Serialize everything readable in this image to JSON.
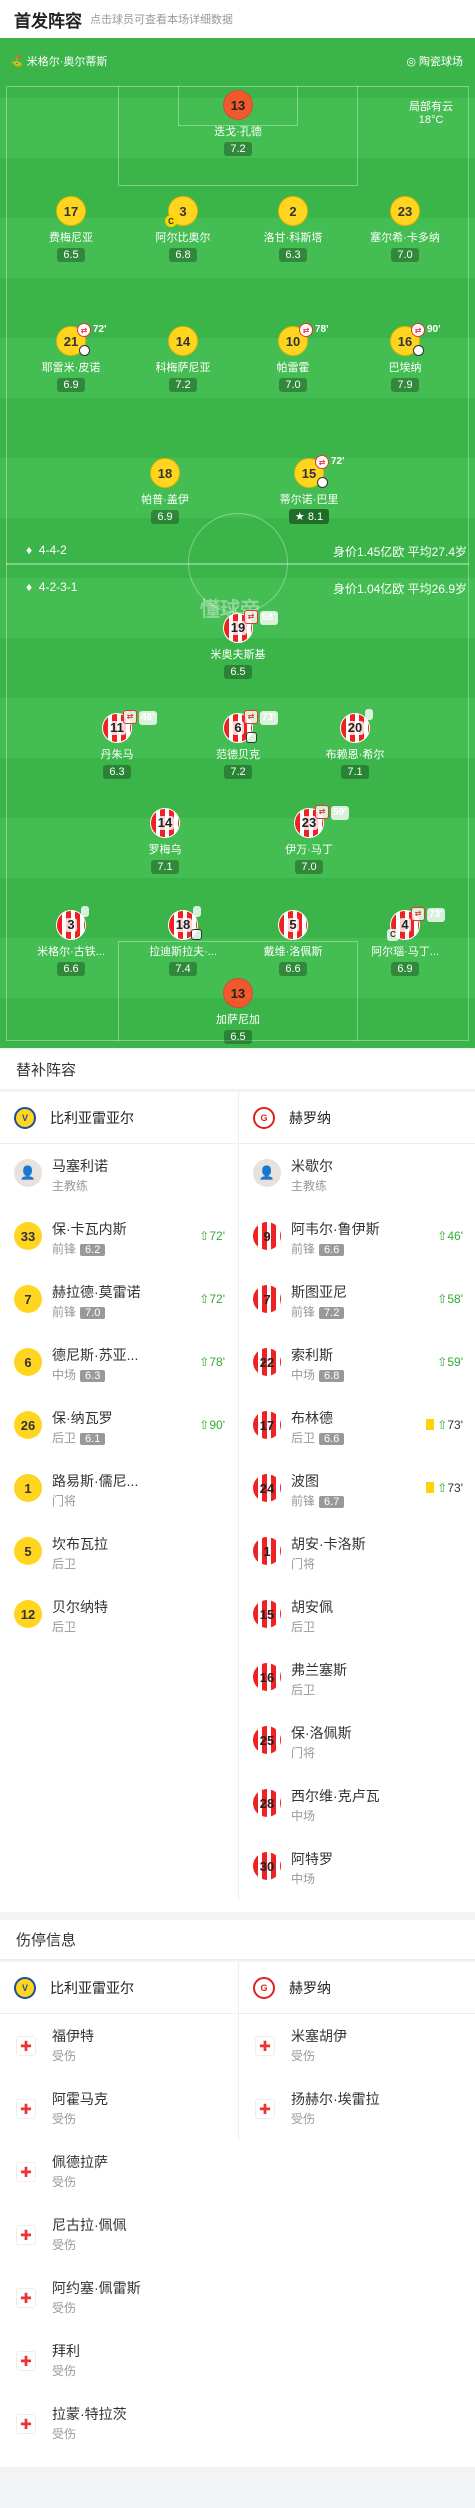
{
  "header": {
    "title": "首发阵容",
    "subtitle": "点击球员可查看本场详细数据"
  },
  "pitch": {
    "referee": "米格尔·奥尔蒂斯",
    "stadium": "陶瓷球场",
    "weather": "局部有云",
    "temperature": "18°C",
    "watermark": "懂球帝"
  },
  "home_team": {
    "name": "比利亚雷亚尔",
    "formation": "4-4-2",
    "stats": "身价1.45亿欧  平均27.4岁",
    "players": [
      {
        "num": "13",
        "name": "迭戈·孔德",
        "rating": "7.2"
      },
      {
        "num": "17",
        "name": "费梅尼亚",
        "rating": "6.5"
      },
      {
        "num": "3",
        "name": "阿尔比奥尔",
        "rating": "6.8"
      },
      {
        "num": "2",
        "name": "洛甘·科斯塔",
        "rating": "6.3"
      },
      {
        "num": "23",
        "name": "塞尔希·卡多纳",
        "rating": "7.0"
      },
      {
        "num": "21",
        "name": "耶雷米·皮诺",
        "rating": "6.9",
        "sub_time": "72'"
      },
      {
        "num": "14",
        "name": "科梅萨尼亚",
        "rating": "7.2"
      },
      {
        "num": "10",
        "name": "帕雷霍",
        "rating": "7.0",
        "sub_time": "78'"
      },
      {
        "num": "16",
        "name": "巴埃纳",
        "rating": "7.9",
        "sub_time": "90'"
      },
      {
        "num": "18",
        "name": "帕普·盖伊",
        "rating": "6.9"
      },
      {
        "num": "15",
        "name": "蒂尔诺·巴里",
        "rating": "8.1",
        "sub_time": "72'"
      }
    ]
  },
  "away_team": {
    "name": "赫罗纳",
    "formation": "4-2-3-1",
    "stats": "身价1.04亿欧  平均26.9岁",
    "players": [
      {
        "num": "19",
        "name": "米奥夫斯基",
        "rating": "6.5",
        "sub_time": "58'"
      },
      {
        "num": "11",
        "name": "丹朱马",
        "rating": "6.3",
        "sub_time": "46'"
      },
      {
        "num": "6",
        "name": "范德贝克",
        "rating": "7.2",
        "sub_time": "73'"
      },
      {
        "num": "20",
        "name": "布赖恩·希尔",
        "rating": "7.1"
      },
      {
        "num": "14",
        "name": "罗梅乌",
        "rating": "7.1"
      },
      {
        "num": "23",
        "name": "伊万·马丁",
        "rating": "7.0",
        "sub_time": "59'"
      },
      {
        "num": "3",
        "name": "米格尔·古铁...",
        "rating": "6.6"
      },
      {
        "num": "18",
        "name": "拉迪斯拉夫·...",
        "rating": "7.4"
      },
      {
        "num": "5",
        "name": "戴维·洛佩斯",
        "rating": "6.6"
      },
      {
        "num": "4",
        "name": "阿尔瑙·马丁...",
        "rating": "6.9",
        "sub_time": "73'"
      },
      {
        "num": "13",
        "name": "加萨尼加",
        "rating": "6.5"
      }
    ]
  },
  "subs": {
    "title": "替补阵容",
    "home": {
      "coach": {
        "name": "马塞利诺",
        "role": "主教练"
      },
      "players": [
        {
          "num": "33",
          "name": "保·卡瓦内斯",
          "pos": "前锋",
          "rating": "6.2",
          "time": "72'"
        },
        {
          "num": "7",
          "name": "赫拉德·莫雷诺",
          "pos": "前锋",
          "rating": "7.0",
          "time": "72'"
        },
        {
          "num": "6",
          "name": "德尼斯·苏亚...",
          "pos": "中场",
          "rating": "6.3",
          "time": "78'"
        },
        {
          "num": "26",
          "name": "保·纳瓦罗",
          "pos": "后卫",
          "rating": "6.1",
          "time": "90'"
        },
        {
          "num": "1",
          "name": "路易斯·儒尼...",
          "pos": "门将"
        },
        {
          "num": "5",
          "name": "坎布瓦拉",
          "pos": "后卫"
        },
        {
          "num": "12",
          "name": "贝尔纳特",
          "pos": "后卫"
        }
      ]
    },
    "away": {
      "coach": {
        "name": "米歇尔",
        "role": "主教练"
      },
      "players": [
        {
          "num": "9",
          "name": "阿韦尔·鲁伊斯",
          "pos": "前锋",
          "rating": "6.6",
          "time": "46'"
        },
        {
          "num": "7",
          "name": "斯图亚尼",
          "pos": "前锋",
          "rating": "7.2",
          "time": "58'"
        },
        {
          "num": "22",
          "name": "索利斯",
          "pos": "中场",
          "rating": "6.8",
          "time": "59'"
        },
        {
          "num": "17",
          "name": "布林德",
          "pos": "后卫",
          "rating": "6.6",
          "time": "73'"
        },
        {
          "num": "24",
          "name": "波图",
          "pos": "前锋",
          "rating": "6.7",
          "time": "73'"
        },
        {
          "num": "1",
          "name": "胡安·卡洛斯",
          "pos": "门将"
        },
        {
          "num": "15",
          "name": "胡安佩",
          "pos": "后卫"
        },
        {
          "num": "16",
          "name": "弗兰塞斯",
          "pos": "后卫"
        },
        {
          "num": "25",
          "name": "保·洛佩斯",
          "pos": "门将"
        },
        {
          "num": "28",
          "name": "西尔维·克卢瓦",
          "pos": "中场"
        },
        {
          "num": "30",
          "name": "阿特罗",
          "pos": "中场"
        }
      ]
    }
  },
  "injuries": {
    "title": "伤停信息",
    "home": [
      {
        "name": "福伊特",
        "status": "受伤"
      },
      {
        "name": "阿霍马克",
        "status": "受伤"
      },
      {
        "name": "佩德拉萨",
        "status": "受伤"
      },
      {
        "name": "尼古拉·佩佩",
        "status": "受伤"
      },
      {
        "name": "阿约塞·佩雷斯",
        "status": "受伤"
      },
      {
        "name": "拜利",
        "status": "受伤"
      },
      {
        "name": "拉蒙·特拉茨",
        "status": "受伤"
      }
    ],
    "away": [
      {
        "name": "米塞胡伊",
        "status": "受伤"
      },
      {
        "name": "扬赫尔·埃雷拉",
        "status": "受伤"
      }
    ]
  },
  "colors": {
    "pitch": "#3bb54a",
    "home": "#ffd51f",
    "away": "#e22222",
    "sub_in": "#33aa33"
  }
}
